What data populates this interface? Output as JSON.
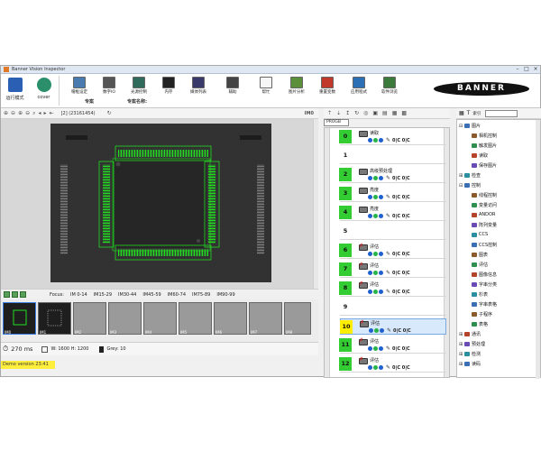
{
  "window": {
    "title": "Banner Vision Inspector"
  },
  "modes": [
    {
      "label": "运行模式"
    },
    {
      "label": "cover"
    }
  ],
  "toolbar_groups": [
    {
      "label": "专案"
    },
    {
      "label": "专案名称:"
    }
  ],
  "toolbar_buttons": [
    {
      "label": "帽框设定"
    },
    {
      "label": "数字IO"
    },
    {
      "label": "光源控制"
    },
    {
      "label": "内存"
    },
    {
      "label": "媒体列表"
    },
    {
      "label": "辅助"
    },
    {
      "label": "帮忙"
    },
    {
      "label": "图片分析"
    },
    {
      "label": "重置变数"
    },
    {
      "label": "应用程式"
    },
    {
      "label": "软件浏览"
    }
  ],
  "brand": {
    "name": "BANNER"
  },
  "image_view": {
    "index_text": "[2]  (23161454)",
    "im_label": "IM0"
  },
  "film_toolbar": {
    "focus_label": "Focus:",
    "ranges": [
      "IM 0-14",
      "IM15-29",
      "IM30-44",
      "IM45-59",
      "IM60-74",
      "IM75-89",
      "IM90-99"
    ]
  },
  "filmstrip": {
    "thumbnails": [
      "IM0",
      "IM1",
      "IM2",
      "IM3",
      "IM4",
      "IM5",
      "IM6",
      "IM7",
      "IM8"
    ]
  },
  "status": {
    "time": "270 ms",
    "width": "W: 1600",
    "height": "H: 1200",
    "grey": "Grey: 10"
  },
  "demo": {
    "text": "Demo version  23:41"
  },
  "program": {
    "tab_label": "PROGB",
    "steps": [
      {
        "num": "0",
        "status": "green",
        "label": "读取",
        "x": false
      },
      {
        "num": "1",
        "status": "none",
        "label": "",
        "x": false
      },
      {
        "num": "2",
        "status": "green",
        "label": "高级预处理",
        "x": false
      },
      {
        "num": "3",
        "status": "green",
        "label": "亮度",
        "x": false
      },
      {
        "num": "4",
        "status": "green",
        "label": "亮度",
        "x": false
      },
      {
        "num": "5",
        "status": "none",
        "label": "",
        "x": false
      },
      {
        "num": "6",
        "status": "green",
        "label": "评估",
        "x": true
      },
      {
        "num": "7",
        "status": "green",
        "label": "评估",
        "x": true
      },
      {
        "num": "8",
        "status": "green",
        "label": "评估",
        "x": true
      },
      {
        "num": "9",
        "status": "none",
        "label": "",
        "x": false
      },
      {
        "num": "10",
        "status": "yellow",
        "label": "评估",
        "x": true
      },
      {
        "num": "11",
        "status": "green",
        "label": "评估",
        "x": true
      },
      {
        "num": "12",
        "status": "green",
        "label": "评估",
        "x": true
      }
    ]
  },
  "tools": {
    "search_label": "索引",
    "tree": [
      {
        "label": "图片",
        "level": 0,
        "toggle": "⊟"
      },
      {
        "label": "相机控制",
        "level": 1,
        "toggle": ""
      },
      {
        "label": "触发图片",
        "level": 1,
        "toggle": ""
      },
      {
        "label": "读取",
        "level": 1,
        "toggle": ""
      },
      {
        "label": "保存图片",
        "level": 1,
        "toggle": ""
      },
      {
        "label": "检查",
        "level": 0,
        "toggle": "⊞"
      },
      {
        "label": "控制",
        "level": 0,
        "toggle": "⊟"
      },
      {
        "label": "线程控制",
        "level": 1,
        "toggle": ""
      },
      {
        "label": "变量访问",
        "level": 1,
        "toggle": ""
      },
      {
        "label": "ANDOR",
        "level": 1,
        "toggle": ""
      },
      {
        "label": "阵列变量",
        "level": 1,
        "toggle": ""
      },
      {
        "label": "CCS",
        "level": 1,
        "toggle": ""
      },
      {
        "label": "CCS控制",
        "level": 1,
        "toggle": ""
      },
      {
        "label": "图表",
        "level": 1,
        "toggle": ""
      },
      {
        "label": "评估",
        "level": 1,
        "toggle": ""
      },
      {
        "label": "图像信息",
        "level": 1,
        "toggle": ""
      },
      {
        "label": "字串分类",
        "level": 1,
        "toggle": ""
      },
      {
        "label": "杉表",
        "level": 1,
        "toggle": ""
      },
      {
        "label": "字串表格",
        "level": 1,
        "toggle": ""
      },
      {
        "label": "子程序",
        "level": 1,
        "toggle": ""
      },
      {
        "label": "表格",
        "level": 1,
        "toggle": ""
      },
      {
        "label": "通讯",
        "level": 0,
        "toggle": "⊞"
      },
      {
        "label": "预处理",
        "level": 0,
        "toggle": "⊞"
      },
      {
        "label": "检测",
        "level": 0,
        "toggle": "⊞"
      },
      {
        "label": "读码",
        "level": 0,
        "toggle": "⊞"
      }
    ]
  },
  "colors": {
    "step_green": "#33cc33",
    "step_yellow": "#ffee00",
    "selection": "#d8e9fb",
    "pin_green": "#22dd22",
    "demo_bg": "#ffef3c"
  }
}
